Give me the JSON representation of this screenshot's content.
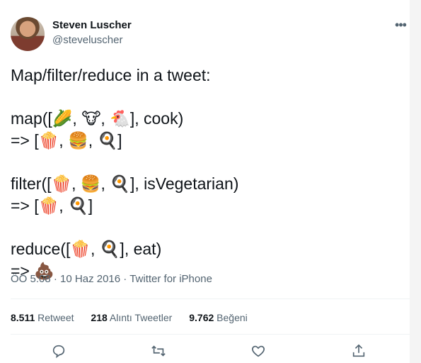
{
  "author": {
    "name": "Steven Luscher",
    "handle": "@steveluscher"
  },
  "more_icon": "•••",
  "tweet": {
    "lines": [
      "Map/filter/reduce in a tweet:",
      "map([🌽, 🐮, 🐔], cook)",
      "=> [🍿, 🍔, 🍳]",
      "filter([🍿, 🍔, 🍳], isVegetarian)",
      "=>  [🍿, 🍳]",
      "reduce([🍿, 🍳], eat)",
      "=> 💩"
    ]
  },
  "meta": {
    "time": "ÖÖ 5:08",
    "dot1": " · ",
    "date": "10 Haz 2016",
    "dot2": " · ",
    "source": "Twitter for iPhone"
  },
  "stats": {
    "retweets_count": "8.511",
    "retweets_label": "Retweet",
    "quotes_count": "218",
    "quotes_label": "Alıntı Tweetler",
    "likes_count": "9.762",
    "likes_label": "Beğeni"
  },
  "actions": [
    "reply-icon",
    "retweet-icon",
    "like-icon",
    "share-icon"
  ],
  "colors": {
    "text": "#0f1419",
    "muted": "#536471",
    "divider": "#eff3f4"
  }
}
